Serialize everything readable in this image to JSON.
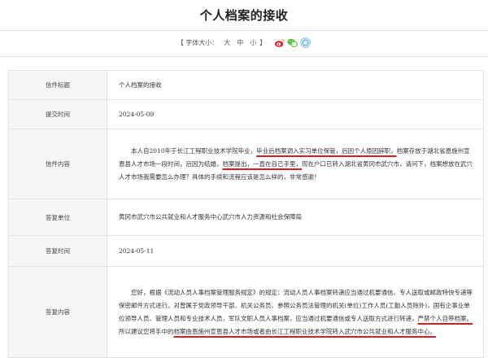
{
  "page": {
    "title": "个人档案的接收"
  },
  "font_size_bar": {
    "label": "【 字体大小：",
    "sizes": [
      "大",
      "中",
      "小"
    ],
    "close": "】"
  },
  "share_icons": [
    "weibo-icon",
    "wechat-icon",
    "qzone-icon"
  ],
  "letter": {
    "title_label": "信件标题",
    "title_value": "个人档案的接收",
    "submit_label": "提交时间",
    "submit_value": "2024-05-09",
    "content_label": "信件内容",
    "content": {
      "p1": "本人自2010年于长江工程职业技术学院毕业，",
      "u1": "毕业后档案调入实习单位保管，后因个人原因辞职，",
      "p2": "档案存放于湖北省恩施州宣恩县人才市场一段时间，后因为结婚，",
      "u2": "档案提出，一直在自己手里，",
      "p3": "现在户口已转入湖北省黄冈市武穴市，请问下，档案想放在武穴人才市场我需要怎么办理？具体的手续和流程应该是怎么样的，非常感谢！"
    },
    "reply_unit_label": "答复单位",
    "reply_unit_value": "黄冈市武穴市公共就业和人才服务中心武穴市人力资源和社会保障局",
    "reply_time_label": "答复时间",
    "reply_time_value": "2024-05-11",
    "reply_content_label": "答复内容",
    "reply": {
      "p1": "您好，根据《流动人员人事档案管理服务规定》的规定：流动人员人事档案转递应当通过机要通信、专人送取或邮政特快专递等保密邮件方式进行。对曾属于党政领导干部、机关公务员、参照公务员法管理的机关(单位)工作人员(工勤人员除外)，国有企事业单位领导人员、管理人员和专业技术人员，军队文职人员人事档案，应当通过机要通信或专人送取方式进行转递，",
      "u1": "严禁个人自带档案。",
      "p2": "所以建议您将手中的",
      "u2": "档案由恩施州宣恩县人才市场或者由长江工程职业技术学院转入武穴市公共就业和人才服务中心。"
    }
  }
}
